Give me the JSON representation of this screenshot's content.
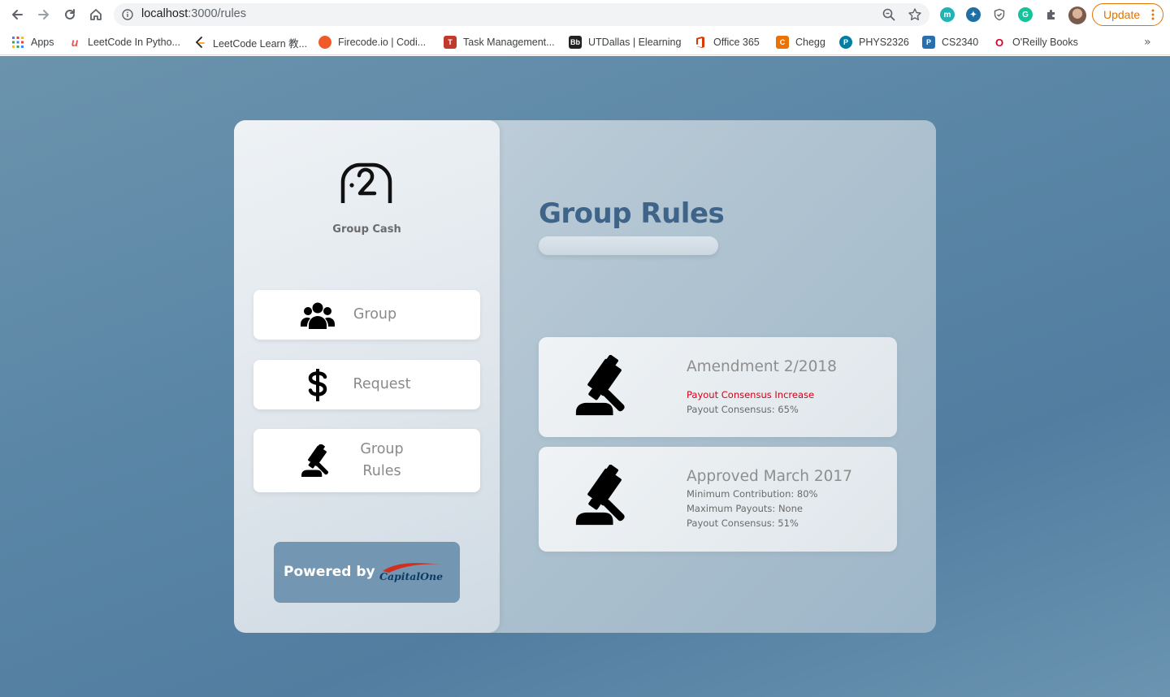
{
  "browser": {
    "url_host": "localhost",
    "url_path": ":3000/rules",
    "update_label": "Update",
    "bookmarks": [
      {
        "label": "Apps",
        "icon": "apps-grid-icon",
        "color": "#4285f4"
      },
      {
        "label": "LeetCode In Pytho...",
        "icon": "udemy-icon",
        "color": "#ec5252"
      },
      {
        "label": "LeetCode Learn 教...",
        "icon": "leetcode-icon",
        "color": "#f89f1b"
      },
      {
        "label": "Firecode.io | Codi...",
        "icon": "firecode-icon",
        "color": "#f05a28"
      },
      {
        "label": "Task Management...",
        "icon": "task-icon",
        "color": "#c0392b"
      },
      {
        "label": "UTDallas | Elearning",
        "icon": "blackboard-icon",
        "color": "#222222"
      },
      {
        "label": "Office 365",
        "icon": "office-icon",
        "color": "#d83b01"
      },
      {
        "label": "Chegg",
        "icon": "chegg-icon",
        "color": "#eb7100"
      },
      {
        "label": "PHYS2326",
        "icon": "pearson-icon",
        "color": "#007fa3"
      },
      {
        "label": "CS2340",
        "icon": "p-icon",
        "color": "#2a6fad"
      },
      {
        "label": "O'Reilly Books",
        "icon": "oreilly-icon",
        "color": "#d3002d"
      }
    ]
  },
  "app": {
    "brand": "Group Cash",
    "nav": [
      {
        "label": "Group",
        "icon": "users-icon"
      },
      {
        "label": "Request",
        "icon": "dollar-icon"
      },
      {
        "label": "Group Rules",
        "icon": "gavel-icon"
      }
    ],
    "powered_by": "Powered by",
    "sponsor_logo": "capital-one-logo",
    "page_title": "Group Rules",
    "rules": [
      {
        "title": "Amendment 2/2018",
        "lines": [
          "Payout Consensus Increase",
          "Payout Consensus: 65%"
        ],
        "highlight_color": "#d0021b"
      },
      {
        "title": "Approved March 2017",
        "lines": [
          "Minimum Contribution: 80%",
          "Maximum Payouts: None",
          "Payout Consensus: 51%"
        ]
      }
    ]
  }
}
